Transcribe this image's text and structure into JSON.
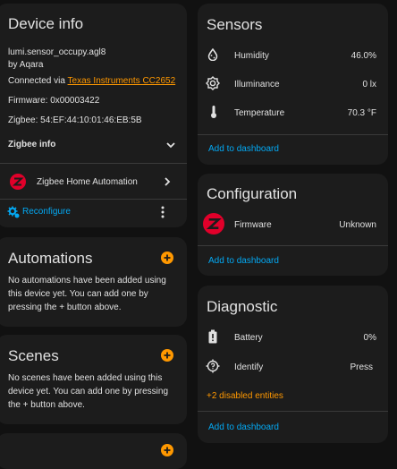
{
  "device_info": {
    "title": "Device info",
    "model": "lumi.sensor_occupy.agl8",
    "manufacturer": "by Aqara",
    "connected_prefix": "Connected via ",
    "connected_link": "Texas Instruments CC2652",
    "firmware": "Firmware: 0x00003422",
    "zigbee": "Zigbee: 54:EF:44:10:01:46:EB:5B",
    "zigbee_info_label": "Zigbee info",
    "integration_label": "Zigbee Home Automation",
    "reconfigure_label": "Reconfigure"
  },
  "automations": {
    "title": "Automations",
    "text": "No automations have been added using this device yet. You can add one by pressing the + button above."
  },
  "scenes": {
    "title": "Scenes",
    "text": "No scenes have been added using this device yet. You can add one by pressing the + button above."
  },
  "sensors": {
    "title": "Sensors",
    "rows": [
      {
        "label": "Humidity",
        "value": "46.0%",
        "icon": "water-percent-icon"
      },
      {
        "label": "Illuminance",
        "value": "0 lx",
        "icon": "brightness-icon"
      },
      {
        "label": "Temperature",
        "value": "70.3 °F",
        "icon": "thermometer-icon"
      }
    ],
    "add_label": "Add to dashboard"
  },
  "configuration": {
    "title": "Configuration",
    "firmware_label": "Firmware",
    "firmware_value": "Unknown",
    "add_label": "Add to dashboard"
  },
  "diagnostic": {
    "title": "Diagnostic",
    "battery_label": "Battery",
    "battery_value": "0%",
    "identify_label": "Identify",
    "identify_action": "Press",
    "disabled_entities": "+2 disabled entities",
    "add_label": "Add to dashboard"
  },
  "colors": {
    "background": "#111111",
    "card": "#1c1c1c",
    "accent_blue": "#03a9f4",
    "accent_orange": "#ff9800",
    "zigbee_red": "#e1002a"
  }
}
